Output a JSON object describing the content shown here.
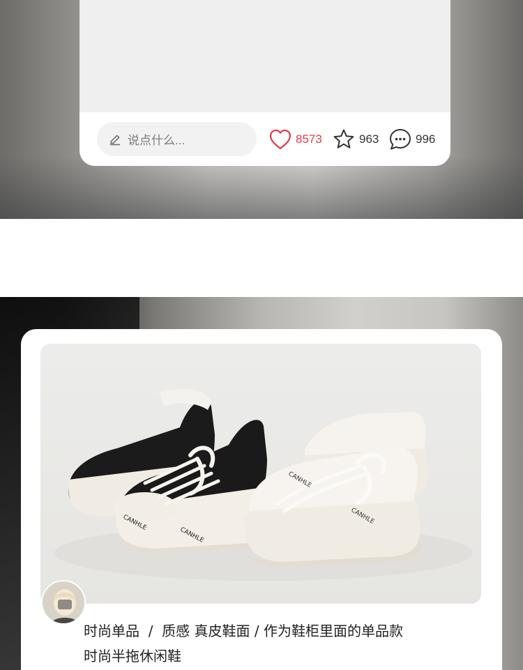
{
  "post_top": {
    "comment_placeholder": "说点什么...",
    "likes": "8573",
    "stars": "963",
    "comments": "996",
    "like_color": "#e9384a"
  },
  "post_bottom": {
    "caption_line1": "时尚单品  /  质感 真皮鞋面 / 作为鞋柜里面的单品款",
    "caption_line2": "时尚半拖休闲鞋",
    "brand_print": "CANHLE"
  },
  "icons": [
    "pencil-icon",
    "heart-icon",
    "star-icon",
    "comment-icon"
  ]
}
